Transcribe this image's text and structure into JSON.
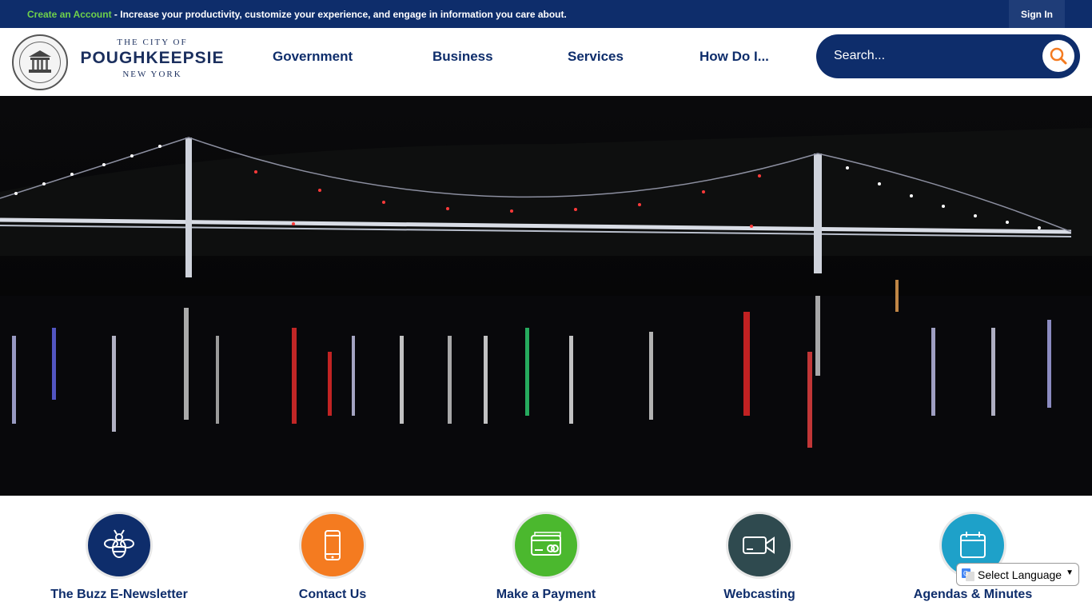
{
  "topbar": {
    "create_link": "Create an Account",
    "message": " - Increase your productivity, customize your experience, and engage in information you care about.",
    "signin": "Sign In"
  },
  "logo": {
    "line1": "THE CITY OF",
    "line2": "POUGHKEEPSIE",
    "line3": "NEW YORK"
  },
  "nav": {
    "items": [
      {
        "label": "Government"
      },
      {
        "label": "Business"
      },
      {
        "label": "Services"
      },
      {
        "label": "How Do I..."
      }
    ]
  },
  "search": {
    "placeholder": "Search...",
    "icon": "search-icon"
  },
  "hero": {
    "description_icon": "bridge-night-photo"
  },
  "quick_links": [
    {
      "label": "The Buzz E-Newsletter",
      "icon": "bee-icon",
      "color": "#0e2d6b"
    },
    {
      "label": "Contact Us",
      "icon": "phone-icon",
      "color": "#f47b20"
    },
    {
      "label": "Make a Payment",
      "icon": "credit-card-icon",
      "color": "#4bb82e"
    },
    {
      "label": "Webcasting",
      "icon": "video-camera-icon",
      "color": "#2f4a4f"
    },
    {
      "label": "Agendas & Minutes",
      "icon": "calendar-icon",
      "color": "#1ea1c9"
    }
  ],
  "language": {
    "label": "Select Language"
  },
  "colors": {
    "navy": "#0e2d6b",
    "green": "#6fd14b",
    "search_accent": "#f47b20"
  }
}
